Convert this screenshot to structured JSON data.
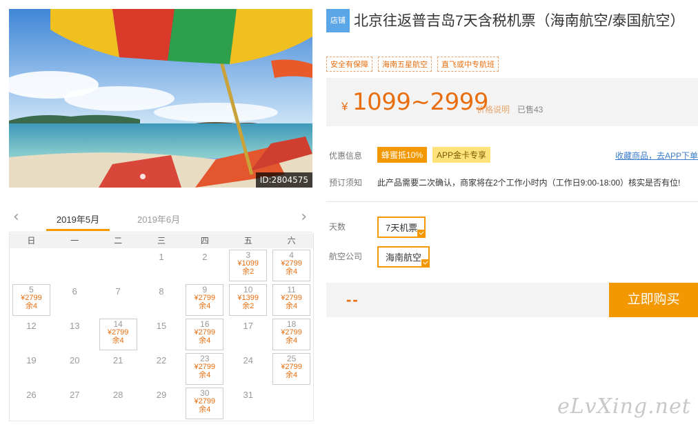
{
  "photo": {
    "id_label": "ID:2804575"
  },
  "calendar": {
    "months": [
      "2019年5月",
      "2019年6月"
    ],
    "weekdays": [
      "日",
      "一",
      "二",
      "三",
      "四",
      "五",
      "六"
    ],
    "cells": [
      {
        "d": ""
      },
      {
        "d": ""
      },
      {
        "d": ""
      },
      {
        "d": "1"
      },
      {
        "d": "2"
      },
      {
        "d": "3",
        "price": "¥1099",
        "left": "余2"
      },
      {
        "d": "4",
        "price": "¥2799",
        "left": "余4"
      },
      {
        "d": "5",
        "price": "¥2799",
        "left": "余4"
      },
      {
        "d": "6"
      },
      {
        "d": "7"
      },
      {
        "d": "8"
      },
      {
        "d": "9",
        "price": "¥2799",
        "left": "余4"
      },
      {
        "d": "10",
        "price": "¥1399",
        "left": "余2"
      },
      {
        "d": "11",
        "price": "¥2799",
        "left": "余4"
      },
      {
        "d": "12"
      },
      {
        "d": "13"
      },
      {
        "d": "14",
        "price": "¥2799",
        "left": "余4"
      },
      {
        "d": "15"
      },
      {
        "d": "16",
        "price": "¥2799",
        "left": "余4"
      },
      {
        "d": "17"
      },
      {
        "d": "18",
        "price": "¥2799",
        "left": "余4"
      },
      {
        "d": "19"
      },
      {
        "d": "20"
      },
      {
        "d": "21"
      },
      {
        "d": "22"
      },
      {
        "d": "23",
        "price": "¥2799",
        "left": "余4"
      },
      {
        "d": "24"
      },
      {
        "d": "25",
        "price": "¥2799",
        "left": "余4"
      },
      {
        "d": "26"
      },
      {
        "d": "27"
      },
      {
        "d": "28"
      },
      {
        "d": "29"
      },
      {
        "d": "30",
        "price": "¥2799",
        "left": "余4"
      },
      {
        "d": "31"
      },
      {
        "d": ""
      }
    ]
  },
  "product": {
    "shop_badge": "店铺",
    "title": "北京往返普吉岛7天含税机票（海南航空/泰国航空）",
    "tags": [
      "安全有保障",
      "海南五星航空",
      "直飞或中专航班"
    ],
    "price_symbol": "¥",
    "price_range": "1099~2999",
    "price_note": "价格说明",
    "sold": "已售43"
  },
  "promo": {
    "label": "优惠信息",
    "badge1": "蜂蜜抵10%",
    "badge2": "APP金卡专享",
    "fav_link": "收藏商品，去APP下单"
  },
  "booking_notice": {
    "label": "预订须知",
    "text": "此产品需要二次确认，商家将在2个工作小时内（工作日9:00-18:00）核实是否有位!"
  },
  "options": {
    "days_label": "天数",
    "days_value": "7天机票",
    "airline_label": "航空公司",
    "airline_value": "海南航空"
  },
  "purchase": {
    "total": "--",
    "buy_label": "立即购买"
  },
  "watermark": "eLvXing.net",
  "colors": {
    "accent": "#f39800",
    "price": "#e86e0f",
    "link": "#3a7ccc",
    "badge_blue": "#5ba6e8"
  }
}
